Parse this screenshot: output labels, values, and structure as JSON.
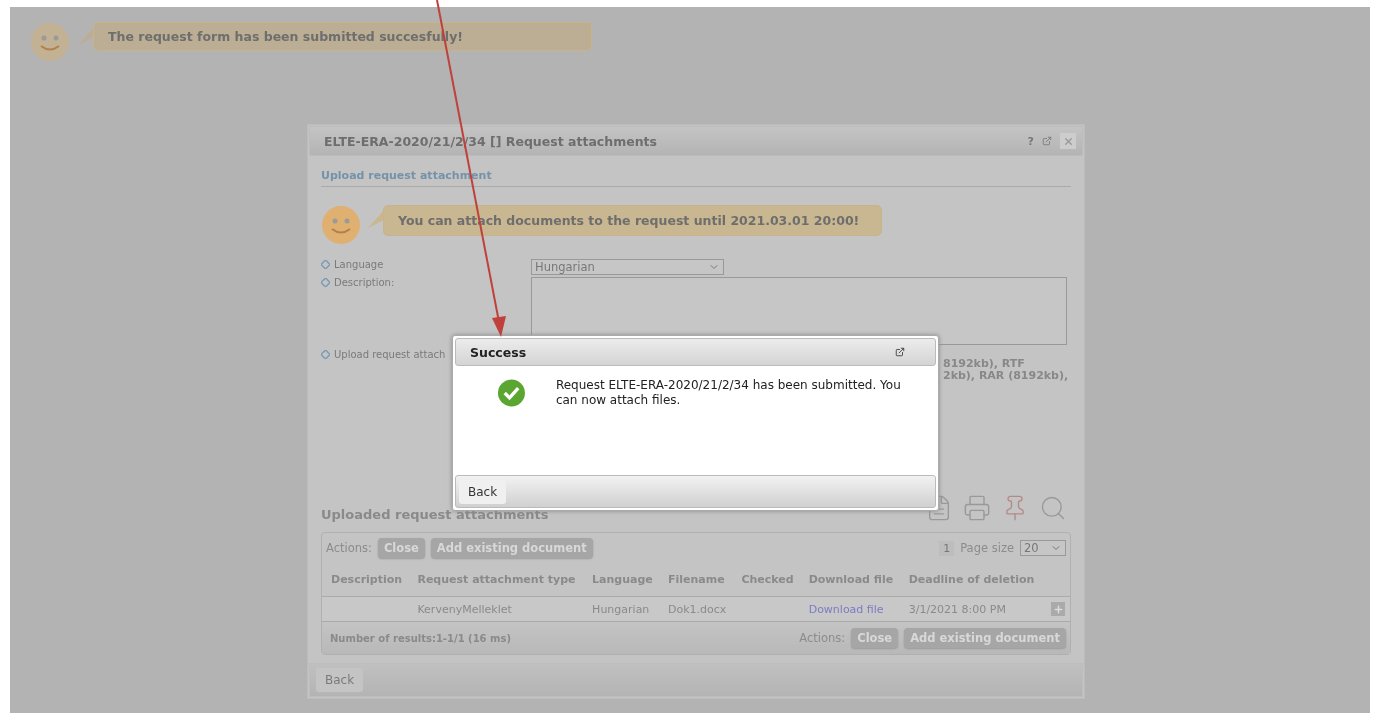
{
  "page_notice": {
    "text": "The request form has been submitted succesfully!"
  },
  "window": {
    "title": "ELTE-ERA-2020/21/2/34 [] Request attachments",
    "help": "?"
  },
  "section_title": "Upload request attachment",
  "notice": {
    "text": "You can attach documents to the request until 2021.03.01 20:00!"
  },
  "form": {
    "language": {
      "label": "Language",
      "value": "Hungarian"
    },
    "description": {
      "label": "Description:"
    },
    "upload": {
      "label": "Upload request attach",
      "formats": [
        "8192kb), RTF",
        "2kb), RAR (8192kb),"
      ]
    }
  },
  "attachments": {
    "title": "Uploaded request attachments",
    "toolbar": {
      "actions_label": "Actions:",
      "buttons": [
        "Close",
        "Add existing document"
      ],
      "page": "1",
      "page_size_label": "Page size",
      "page_size": "20"
    },
    "columns": [
      "Description",
      "Request attachment type",
      "Language",
      "Filename",
      "Checked",
      "Download file",
      "Deadline of deletion"
    ],
    "rows": [
      {
        "description": "",
        "type": "KervenyMelleklet",
        "language": "Hungarian",
        "filename": "Dok1.docx",
        "download": "Download file",
        "deadline": "3/1/2021 8:00 PM"
      }
    ],
    "footer": {
      "results": "Number of results:1-1/1 (16 ms)",
      "actions_label": "Actions:",
      "buttons": [
        "Close",
        "Add existing document"
      ]
    }
  },
  "footer_button": "Back",
  "dialog": {
    "title": "Success",
    "message": "Request ELTE-ERA-2020/21/2/34 has been submitted. You can now attach files.",
    "button": "Back"
  }
}
